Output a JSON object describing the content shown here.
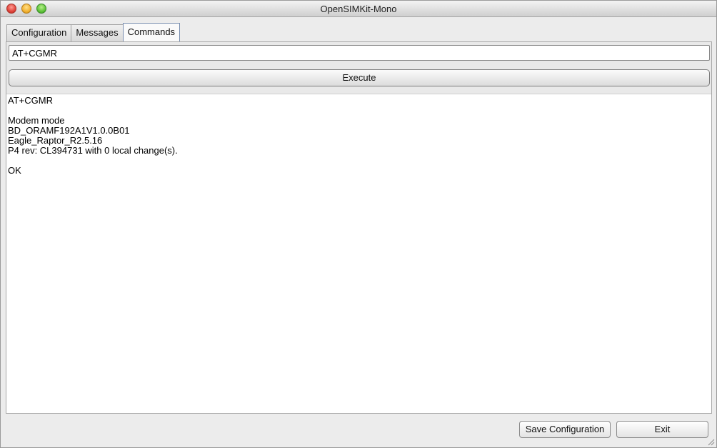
{
  "window": {
    "title": "OpenSIMKit-Mono"
  },
  "tabs": [
    {
      "label": "Configuration"
    },
    {
      "label": "Messages"
    },
    {
      "label": "Commands"
    }
  ],
  "command": {
    "input_value": "AT+CGMR",
    "execute_label": "Execute"
  },
  "output": {
    "lines": [
      "AT+CGMR",
      "",
      "Modem mode",
      "BD_ORAMF192A1V1.0.0B01",
      "Eagle_Raptor_R2.5.16",
      "P4 rev: CL394731 with 0 local change(s).",
      "",
      "OK"
    ]
  },
  "footer": {
    "save_label": "Save Configuration",
    "exit_label": "Exit"
  }
}
